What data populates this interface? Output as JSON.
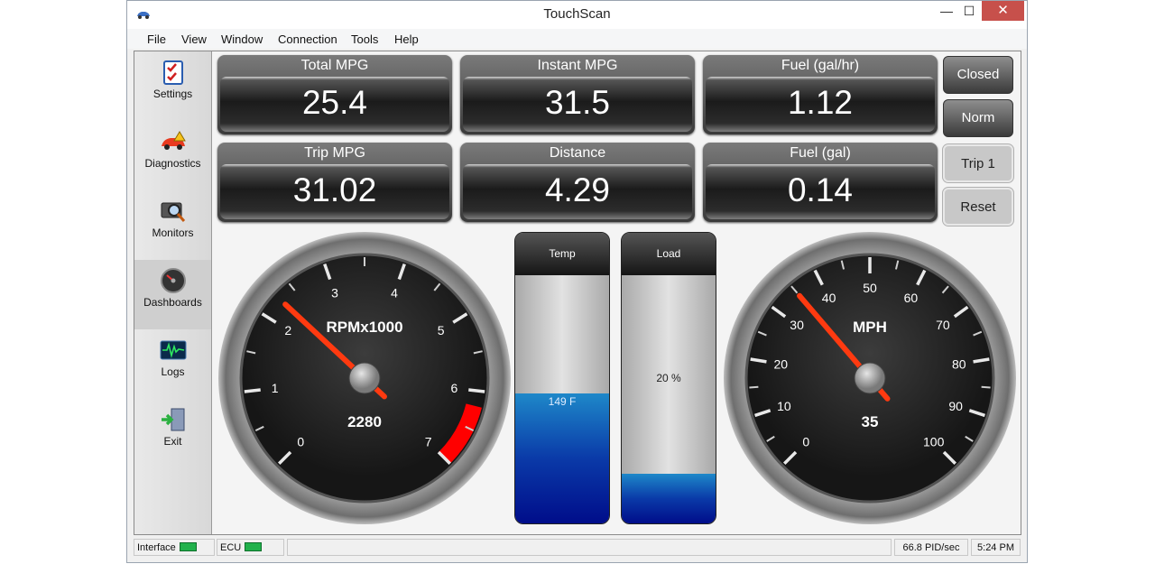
{
  "window": {
    "title": "TouchScan",
    "minimize": "—",
    "maximize": "☐",
    "close": "✕"
  },
  "menu": [
    "File",
    "View",
    "Window",
    "Connection",
    "Tools",
    "Help"
  ],
  "sidebar": [
    {
      "label": "Settings",
      "icon": "settings-checklist-icon"
    },
    {
      "label": "Diagnostics",
      "icon": "car-warning-icon"
    },
    {
      "label": "Monitors",
      "icon": "magnifier-monitor-icon"
    },
    {
      "label": "Dashboards",
      "icon": "gauge-icon"
    },
    {
      "label": "Logs",
      "icon": "waveform-log-icon"
    },
    {
      "label": "Exit",
      "icon": "exit-door-icon"
    }
  ],
  "panels": [
    {
      "label": "Total MPG",
      "value": "25.4"
    },
    {
      "label": "Instant MPG",
      "value": "31.5"
    },
    {
      "label": "Fuel (gal/hr)",
      "value": "1.12"
    },
    {
      "label": "Trip MPG",
      "value": "31.02"
    },
    {
      "label": "Distance",
      "value": "4.29"
    },
    {
      "label": "Fuel (gal)",
      "value": "0.14"
    }
  ],
  "buttons": {
    "closed": "Closed",
    "norm": "Norm",
    "trip": "Trip 1",
    "reset": "Reset"
  },
  "bars": {
    "temp": {
      "label": "Temp",
      "value_text": "149 F",
      "fill_fraction": 0.52
    },
    "load": {
      "label": "Load",
      "value_text": "20 %",
      "fill_fraction": 0.2
    }
  },
  "rpm_gauge": {
    "title": "RPMx1000",
    "readout": "2280",
    "value": 2.28,
    "min": 0,
    "max": 7,
    "ticks": [
      "0",
      "1",
      "2",
      "3",
      "4",
      "5",
      "6",
      "7"
    ],
    "redline_from": 6.2
  },
  "mph_gauge": {
    "title": "MPH",
    "readout": "35",
    "value": 35,
    "min": 0,
    "max": 100,
    "ticks": [
      "0",
      "10",
      "20",
      "30",
      "40",
      "50",
      "60",
      "70",
      "80",
      "90",
      "100"
    ]
  },
  "status": {
    "interface": "Interface",
    "ecu": "ECU",
    "pid_rate": "66.8 PID/sec",
    "time": "5:24 PM"
  },
  "colors": {
    "needle": "#ff3a10",
    "redline": "#ff0000",
    "led": "#22b14c"
  }
}
